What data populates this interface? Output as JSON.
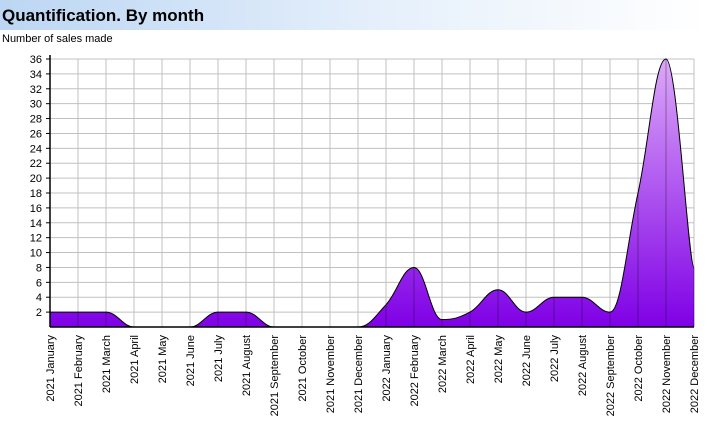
{
  "chart_data": {
    "type": "area",
    "title": "Quantification. By month",
    "ylabel": "Number of sales made",
    "xlabel": "",
    "ylim": [
      0,
      36
    ],
    "yticks": [
      2,
      4,
      6,
      8,
      10,
      12,
      14,
      16,
      18,
      20,
      22,
      24,
      26,
      28,
      30,
      32,
      34,
      36
    ],
    "grid": true,
    "categories": [
      "2021 January",
      "2021 February",
      "2021 March",
      "2021 April",
      "2021 May",
      "2021 June",
      "2021 July",
      "2021 August",
      "2021 September",
      "2021 October",
      "2021 November",
      "2021 December",
      "2022 January",
      "2022 February",
      "2022 March",
      "2022 April",
      "2022 May",
      "2022 June",
      "2022 July",
      "2022 August",
      "2022 September",
      "2022 October",
      "2022 November",
      "2022 December"
    ],
    "values": [
      2,
      2,
      2,
      0,
      0,
      0,
      2,
      2,
      0,
      0,
      0,
      0,
      3,
      8,
      1,
      2,
      5,
      2,
      4,
      4,
      2,
      18,
      36,
      8
    ],
    "colors": {
      "fill_top": "#dca8f8",
      "fill_bottom": "#7f00e6",
      "stroke": "#000000",
      "grid": "#c0c0c0"
    }
  }
}
